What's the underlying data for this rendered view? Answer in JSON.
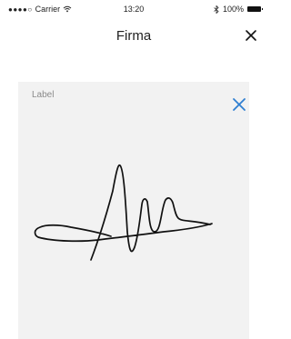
{
  "status_bar": {
    "signal_dots": "●●●●○",
    "carrier": "Carrier",
    "wifi_icon": "wifi-icon",
    "time": "13:20",
    "bluetooth_icon": "bluetooth-icon",
    "battery_text": "100%",
    "battery_icon": "battery-icon"
  },
  "nav": {
    "title": "Firma",
    "close_icon": "close-icon"
  },
  "signature": {
    "label": "Label",
    "clear_icon": "clear-icon",
    "accent_color": "#2f7fd1",
    "ink_color": "#111111"
  }
}
